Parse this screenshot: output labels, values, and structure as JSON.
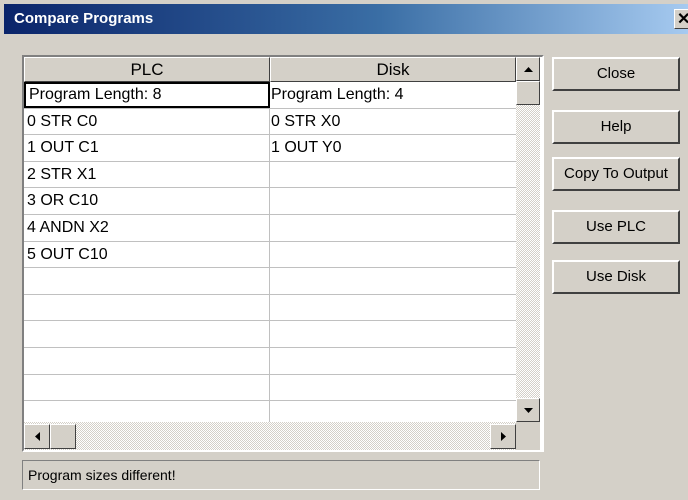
{
  "window": {
    "title": "Compare Programs",
    "close_glyph": "✕"
  },
  "grid": {
    "columns": [
      "PLC",
      "Disk"
    ],
    "rows": [
      [
        "Program Length: 8",
        "Program Length: 4"
      ],
      [
        "0  STR  C0",
        "0 STR  X0"
      ],
      [
        "1  OUT  C1",
        "1 OUT  Y0"
      ],
      [
        "2  STR  X1",
        ""
      ],
      [
        "3  OR  C10",
        ""
      ],
      [
        "4  ANDN  X2",
        ""
      ],
      [
        "5  OUT  C10",
        ""
      ],
      [
        "",
        ""
      ],
      [
        "",
        ""
      ],
      [
        "",
        ""
      ],
      [
        "",
        ""
      ],
      [
        "",
        ""
      ],
      [
        "",
        ""
      ]
    ]
  },
  "buttons": {
    "close": "Close",
    "help": "Help",
    "copy_to_output": "Copy To Output",
    "use_plc": "Use PLC",
    "use_disk": "Use Disk"
  },
  "status": "Program sizes different!",
  "icons": {
    "scroll_up": "arrow-up-icon",
    "scroll_down": "arrow-down-icon",
    "scroll_left": "arrow-left-icon",
    "scroll_right": "arrow-right-icon"
  },
  "colors": {
    "titlebar_start": "#0a246a",
    "titlebar_end": "#a6caf0",
    "face": "#d4d0c8"
  }
}
